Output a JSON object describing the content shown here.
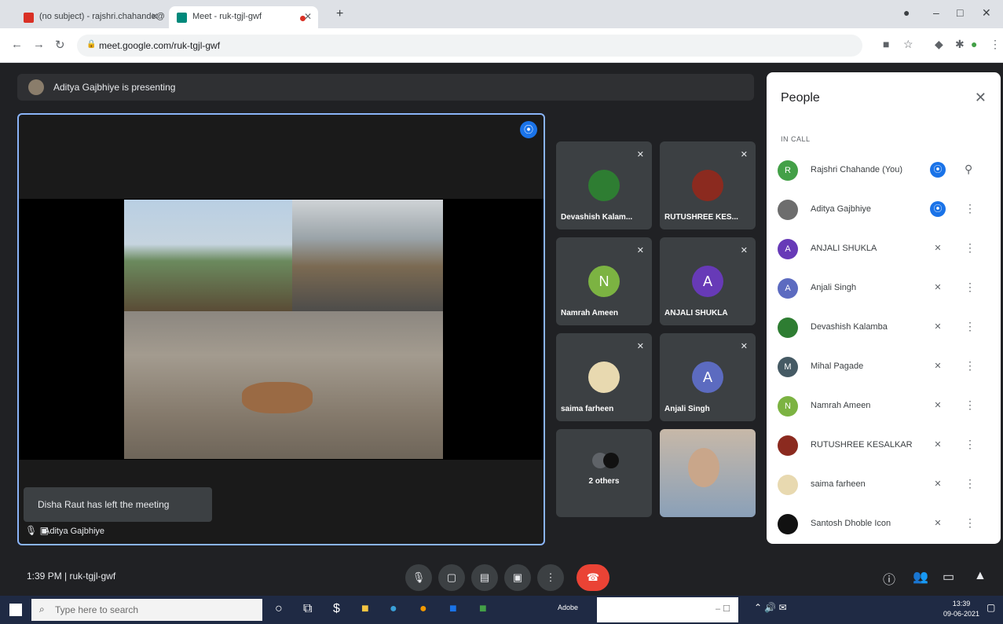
{
  "browser": {
    "tabs": [
      {
        "label": "(no subject) - rajshri.chahande@...",
        "favicon_color": "#d93025"
      },
      {
        "label": "Meet - ruk-tgjl-gwf",
        "favicon_color": "#00897b"
      }
    ],
    "url": "meet.google.com/ruk-tgjl-gwf",
    "new_tab": "+",
    "win_min": "–",
    "win_max": "□",
    "win_close": "✕"
  },
  "meet": {
    "presenting_text": "Aditya Gajbhiye is presenting",
    "presenter_name": "Aditya Gajbhiye",
    "toast": "Disha Raut has left the meeting",
    "time": "1:39 PM",
    "meeting_code": "ruk-tgjl-gwf",
    "tiles": [
      {
        "name": "Devashish Kalam...",
        "initial": "",
        "avatar_color": "#2e7d32",
        "type": "photo"
      },
      {
        "name": "RUTUSHREE KES...",
        "initial": "",
        "avatar_color": "#8b2a1f",
        "type": "photo"
      },
      {
        "name": "Namrah Ameen",
        "initial": "N",
        "avatar_color": "#7cb342",
        "type": "letter"
      },
      {
        "name": "ANJALI SHUKLA",
        "initial": "A",
        "avatar_color": "#673ab7",
        "type": "letter"
      },
      {
        "name": "saima farheen",
        "initial": "",
        "avatar_color": "#e8d9b0",
        "type": "photo"
      },
      {
        "name": "Anjali Singh",
        "initial": "A",
        "avatar_color": "#5c6bc0",
        "type": "letter"
      },
      {
        "name": "2 others",
        "initial": "",
        "avatar_color": "#5f6368",
        "type": "others"
      },
      {
        "name": "",
        "initial": "",
        "avatar_color": "#8aa0b8",
        "type": "video"
      }
    ]
  },
  "people": {
    "title": "People",
    "section": "IN CALL",
    "list": [
      {
        "name": "Rajshri Chahande (You)",
        "initial": "R",
        "color": "#43a047",
        "status": "speaking",
        "action": "pin"
      },
      {
        "name": "Aditya Gajbhiye",
        "initial": "",
        "color": "#6d6d6d",
        "status": "speaking",
        "action": "more"
      },
      {
        "name": "ANJALI SHUKLA",
        "initial": "A",
        "color": "#673ab7",
        "status": "muted",
        "action": "more"
      },
      {
        "name": "Anjali Singh",
        "initial": "A",
        "color": "#5c6bc0",
        "status": "muted",
        "action": "more"
      },
      {
        "name": "Devashish Kalamba",
        "initial": "",
        "color": "#2e7d32",
        "status": "muted",
        "action": "more"
      },
      {
        "name": "Mihal Pagade",
        "initial": "M",
        "color": "#455a64",
        "status": "muted",
        "action": "more"
      },
      {
        "name": "Namrah Ameen",
        "initial": "N",
        "color": "#7cb342",
        "status": "muted",
        "action": "more"
      },
      {
        "name": "RUTUSHREE KESALKAR",
        "initial": "",
        "color": "#8b2a1f",
        "status": "muted",
        "action": "more"
      },
      {
        "name": "saima farheen",
        "initial": "",
        "color": "#e8d9b0",
        "status": "muted",
        "action": "more"
      },
      {
        "name": "Santosh Dhoble Icon",
        "initial": "",
        "color": "#111111",
        "status": "muted",
        "action": "more"
      }
    ]
  },
  "taskbar": {
    "search_placeholder": "Type here to search",
    "app_label": "Adobe",
    "time": "13:39",
    "date": "09-06-2021"
  },
  "colors": {
    "accent": "#1a73e8",
    "end_call": "#ea4335",
    "stage_border": "#8ab4f8"
  }
}
